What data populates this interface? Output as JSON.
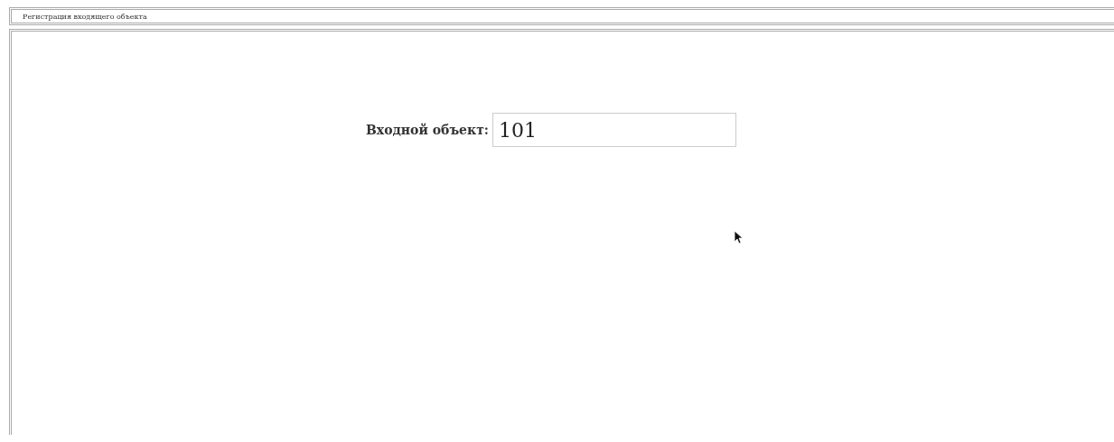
{
  "window": {
    "title": "Регистрация входящего объекта"
  },
  "form": {
    "label": "Входной объект:",
    "value": "101"
  }
}
